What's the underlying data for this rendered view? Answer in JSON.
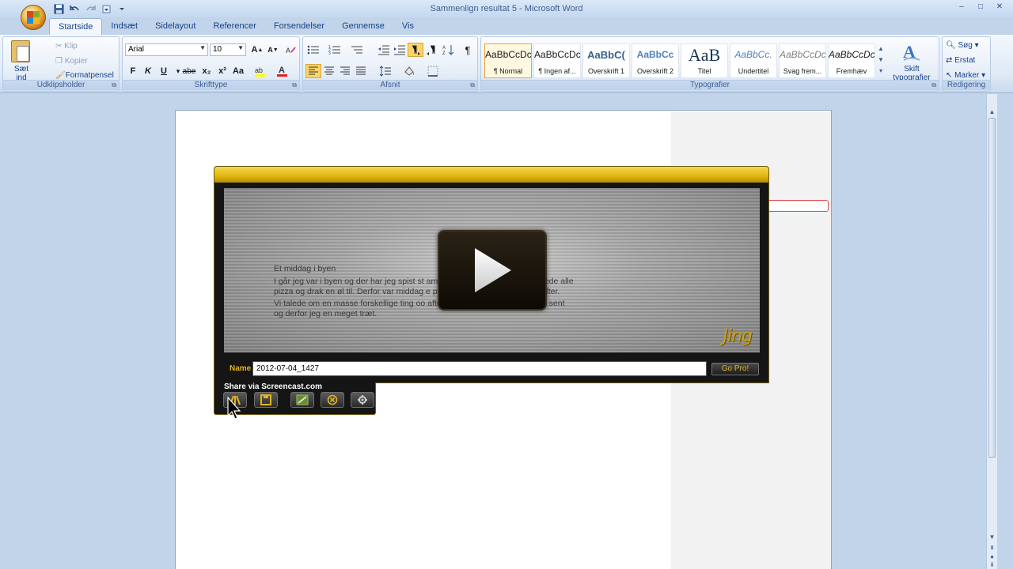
{
  "window": {
    "title": "Sammenlign resultat 5 - Microsoft Word",
    "controls": [
      "–",
      "□",
      "✕"
    ]
  },
  "quick_access": [
    "save-icon",
    "undo-icon",
    "redo-icon",
    "customize-icon"
  ],
  "tabs": [
    {
      "label": "Startside",
      "active": true
    },
    {
      "label": "Indsæt"
    },
    {
      "label": "Sidelayout"
    },
    {
      "label": "Referencer"
    },
    {
      "label": "Forsendelser"
    },
    {
      "label": "Gennemse"
    },
    {
      "label": "Vis"
    }
  ],
  "ribbon": {
    "clipboard": {
      "label": "Udklipsholder",
      "paste": "Sæt ind",
      "cut": "Klip",
      "copy": "Kopier",
      "format_painter": "Formatpensel"
    },
    "font": {
      "label": "Skrifttype",
      "font_name": "Arial",
      "font_size": "10",
      "bold": "F",
      "italic": "K",
      "underline": "U",
      "strike": "abe",
      "subscript": "x₂",
      "superscript": "x²",
      "change_case": "Aa"
    },
    "paragraph": {
      "label": "Afsnit"
    },
    "styles": {
      "label": "Typografier",
      "items": [
        {
          "sample": "AaBbCcDc",
          "name": "¶ Normal",
          "selected": true
        },
        {
          "sample": "AaBbCcDc",
          "name": "¶ Ingen af..."
        },
        {
          "sample": "AaBbC(",
          "name": "Overskrift 1"
        },
        {
          "sample": "AaBbCc",
          "name": "Overskrift 2"
        },
        {
          "sample": "AaB",
          "name": "Titel"
        },
        {
          "sample": "AaBbCc.",
          "name": "Undertitel"
        },
        {
          "sample": "AaBbCcDc",
          "name": "Svag frem..."
        },
        {
          "sample": "AaBbCcDc",
          "name": "Fremhæv"
        }
      ],
      "change_styles": "Skift typografier"
    },
    "editing": {
      "label": "Redigering",
      "find": "Søg",
      "replace": "Erstat",
      "select": "Marker"
    }
  },
  "jing": {
    "doc_preview": {
      "heading": "Et middag i byen",
      "line1": "I går jeg var i byen og der har jeg spist st                                   amen med mine venner. Vi spis/ede alle",
      "line2": "pizza og drak en øl til. Derfor var middag                                     e penge nok til at gå i byen bagefter.",
      "line3": "Vi talede om en masse forskellige ting oo                                     aften. Jeg kom først hjem meget sent",
      "line4": "og derfor jeg en meget træt."
    },
    "logo": "Jing",
    "name_label": "Name",
    "name_value": "2012-07-04_1427",
    "go_pro": "Go Pro!",
    "share_label": "Share via Screencast.com",
    "share_buttons": [
      "share-screencast-icon",
      "save-icon",
      "flash-icon",
      "cancel-icon",
      "settings-icon"
    ]
  }
}
